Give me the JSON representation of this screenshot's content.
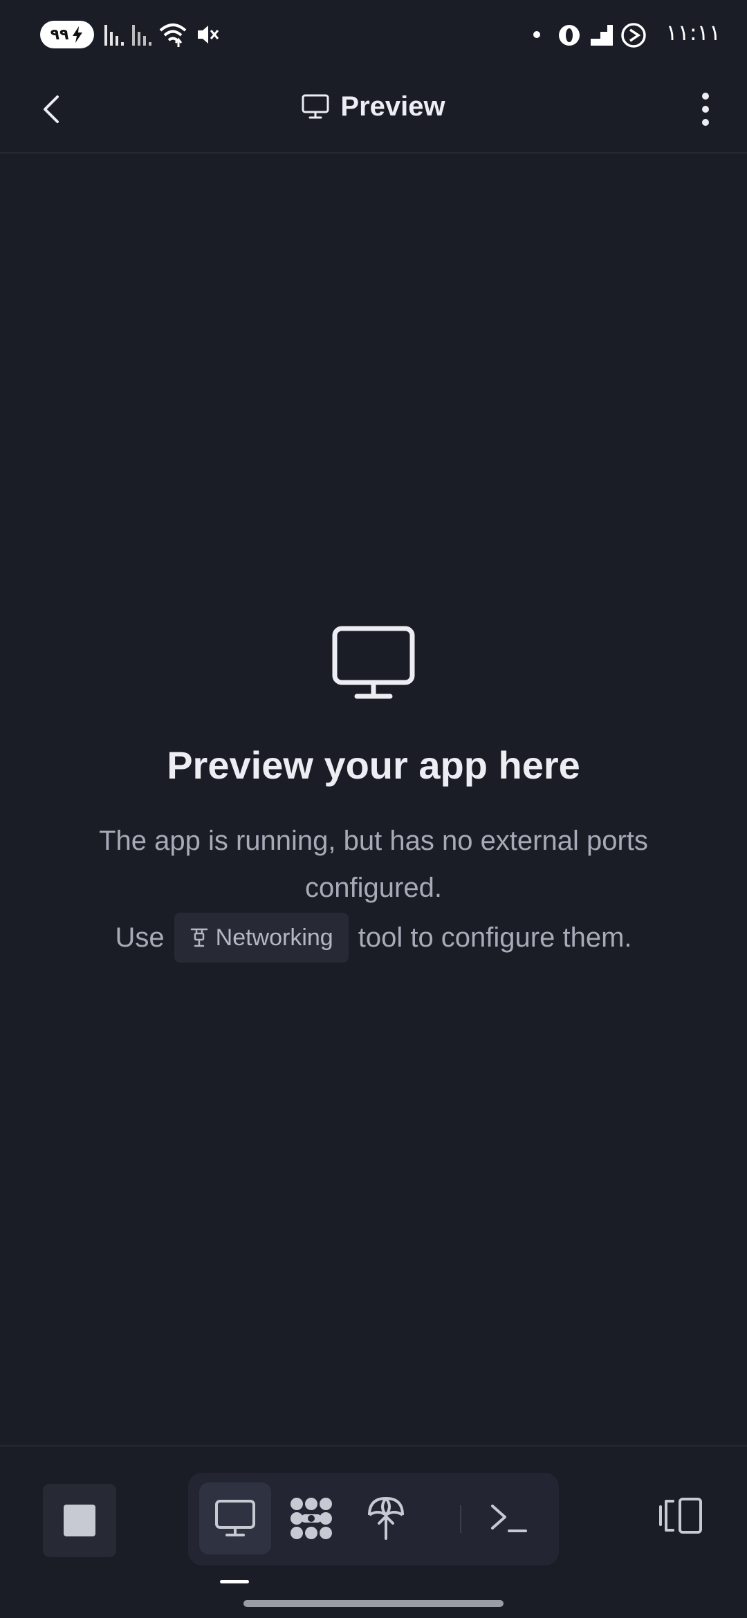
{
  "status_bar": {
    "battery": "٩٩",
    "time": "١١:١١"
  },
  "header": {
    "title": "Preview",
    "title_icon": "monitor-icon",
    "back_icon": "chevron-left-icon",
    "menu_icon": "more-vertical-icon"
  },
  "empty_state": {
    "icon": "monitor-icon",
    "title": "Preview your app here",
    "description": "The app is running, but has no external ports configured.",
    "use_label": "Use",
    "tool_chip": "Networking",
    "tool_chip_icon": "networking-icon",
    "suffix": "tool to configure them."
  },
  "toolbar": {
    "stop_icon": "stop-icon",
    "tools": [
      {
        "icon": "monitor-icon",
        "active": true
      },
      {
        "icon": "workflow-icon",
        "active": false
      },
      {
        "icon": "deploy-icon",
        "active": false
      },
      {
        "icon": "terminal-icon",
        "active": false
      }
    ],
    "devices_icon": "devices-icon"
  },
  "colors": {
    "background": "#1b1d26",
    "surface": "#272a35",
    "text_primary": "#eceef3",
    "text_secondary": "#a7abb8"
  }
}
